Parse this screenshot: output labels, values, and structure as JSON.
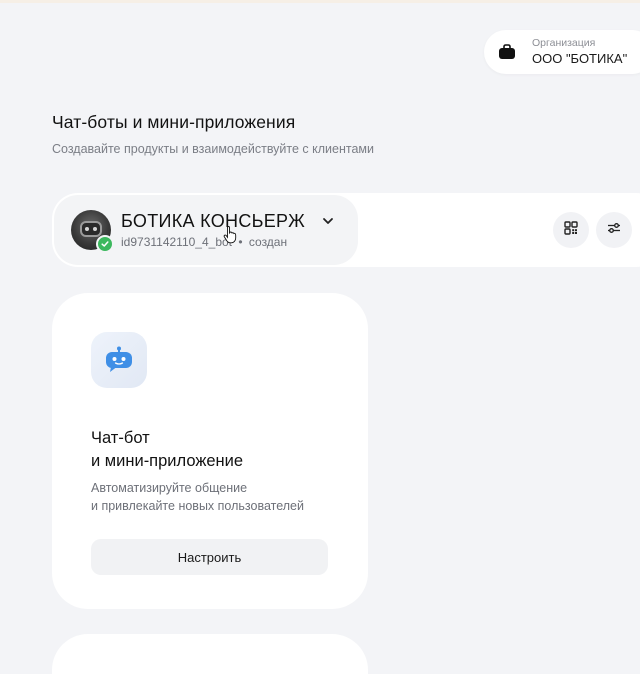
{
  "organization": {
    "label": "Организация",
    "value": "ООО \"БОТИКА\"",
    "icon": "briefcase-icon"
  },
  "page": {
    "title": "Чат-боты и мини-приложения",
    "subtitle": "Создавайте продукты и взаимодействуйте с клиентами"
  },
  "bot": {
    "name": "БОТИКА КОНСЬЕРЖ",
    "id": "id9731142110_4_bot",
    "separator": "•",
    "status": "создан",
    "status_color": "#3cb85e"
  },
  "toolbar": {
    "qr_icon": "qr-code-icon",
    "settings_icon": "sliders-icon"
  },
  "card": {
    "title_line1": "Чат-бот",
    "title_line2": "и мини-приложение",
    "desc_line1": "Автоматизируйте общение",
    "desc_line2": "и привлекайте новых пользователей",
    "button_label": "Настроить",
    "icon": "robot-chat-icon"
  }
}
